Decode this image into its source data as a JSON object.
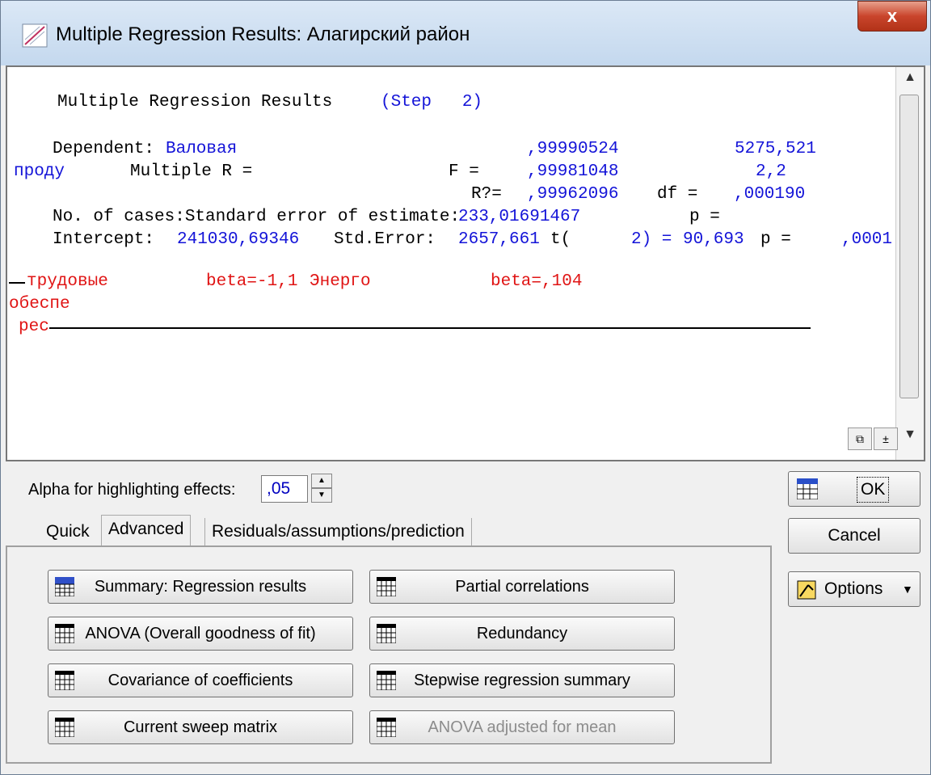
{
  "window": {
    "title": "Multiple Regression Results: Алагирский район",
    "close_label": "x"
  },
  "results": {
    "heading": "Multiple Regression Results",
    "heading_step": "(Step   2)",
    "dependent_label": "Dependent:",
    "dependent_value": "Валовая",
    "dependent_value2": "проду",
    "multiple_r_label": "Multiple R =",
    "multiple_r": ",99990524",
    "f_label": "F =",
    "f_value": "5275,521",
    "r_squared": ",99981048",
    "df_value": "2,2",
    "r2_label": "R?=",
    "adj_r2": ",99962096",
    "df_label": "df =",
    "p_value1": ",000190",
    "cases_line": "No. of cases:Standard error of estimate:",
    "std_err_est": "233,01691467",
    "p_label1": "p =",
    "intercept_label": "Intercept:",
    "intercept_value": "241030,69346",
    "std_error_label": "Std.Error:",
    "std_error_value": "2657,661",
    "t_label": "t(",
    "t_df": "2) =",
    "t_value": "90,693",
    "p_label2": "p =",
    "p_value2": ",0001",
    "effect1_a": "трудовые",
    "effect1_b": "обеспе",
    "effect1_c": "рес",
    "beta1": "beta=-1,1",
    "effect2": "Энерго",
    "beta2": "beta=,104"
  },
  "alpha": {
    "label": "Alpha for highlighting effects:",
    "value": ",05"
  },
  "tabs": [
    {
      "label": "Quick"
    },
    {
      "label": "Advanced"
    },
    {
      "label": "Residuals/assumptions/prediction"
    }
  ],
  "buttons": {
    "summary": "Summary:  Regression results",
    "anova": "ANOVA (Overall goodness of fit)",
    "covariance": "Covariance of coefficients",
    "sweep": "Current sweep matrix",
    "partial": "Partial correlations",
    "redundancy": "Redundancy",
    "stepwise": "Stepwise regression summary",
    "anova_adj": "ANOVA adjusted for mean"
  },
  "side": {
    "ok": "OK",
    "cancel": "Cancel",
    "options": "Options"
  }
}
